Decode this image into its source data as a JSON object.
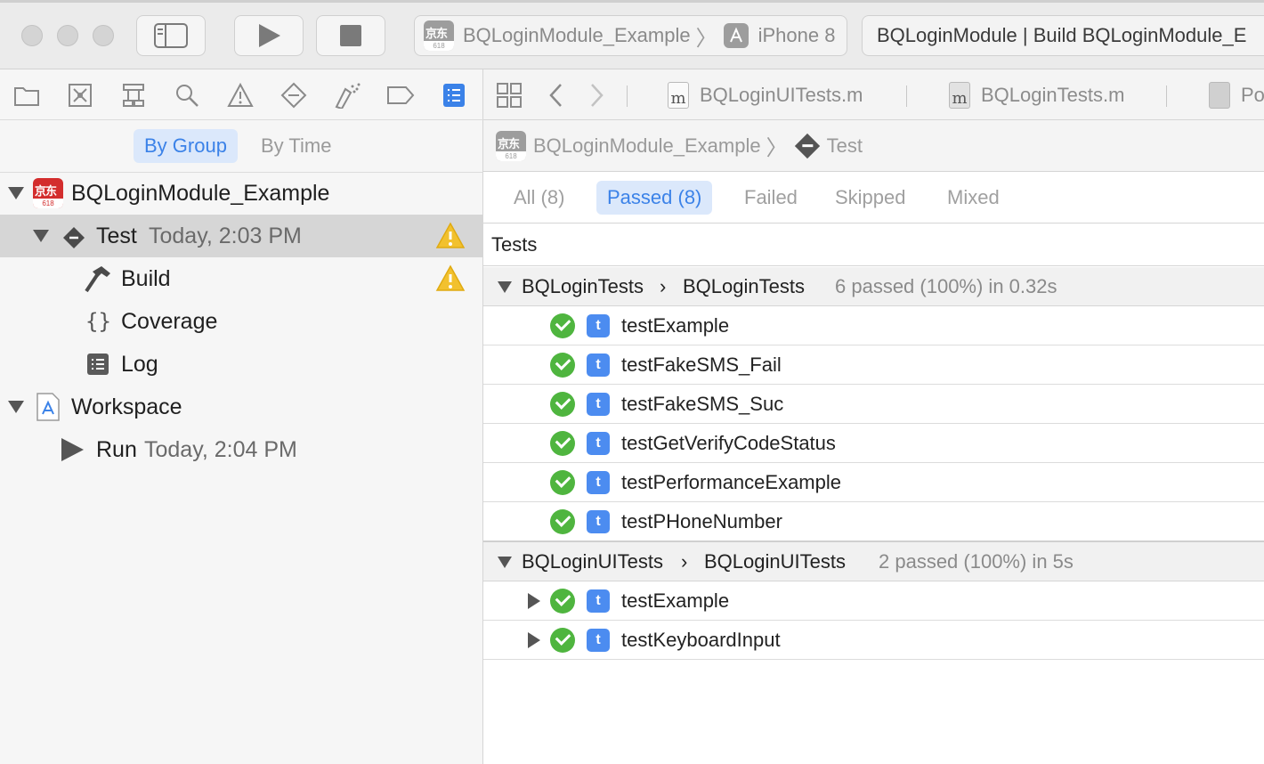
{
  "toolbar": {
    "scheme_name": "BQLoginModule_Example",
    "device_name": "iPhone 8",
    "status_text": "BQLoginModule | Build BQLoginModule_E",
    "app_icon_text": "京东",
    "app_icon_sub": "618"
  },
  "navigator": {
    "icons": [
      "folder-icon",
      "source-control-icon",
      "hierarchy-icon",
      "search-icon",
      "warning-icon",
      "test-icon",
      "debug-icon",
      "breakpoint-icon",
      "report-icon"
    ],
    "segments": {
      "by_group": "By Group",
      "by_time": "By Time"
    },
    "tree": {
      "project": {
        "label": "BQLoginModule_Example"
      },
      "test": {
        "label": "Test",
        "time": "Today, 2:03 PM"
      },
      "build": {
        "label": "Build"
      },
      "coverage": {
        "label": "Coverage"
      },
      "log": {
        "label": "Log"
      },
      "workspace": {
        "label": "Workspace"
      },
      "run": {
        "label": "Run",
        "time": "Today, 2:04 PM"
      }
    }
  },
  "editor": {
    "tabs": [
      "BQLoginUITests.m",
      "BQLoginTests.m",
      "Po"
    ],
    "breadcrumb": {
      "project": "BQLoginModule_Example",
      "item": "Test"
    },
    "filters": {
      "all": "All (8)",
      "passed": "Passed (8)",
      "failed": "Failed",
      "skipped": "Skipped",
      "mixed": "Mixed"
    },
    "tests_header": "Tests",
    "groups": [
      {
        "target": "BQLoginTests",
        "suite": "BQLoginTests",
        "summary": "6 passed (100%) in 0.32s",
        "tests": [
          "testExample",
          "testFakeSMS_Fail",
          "testFakeSMS_Suc",
          "testGetVerifyCodeStatus",
          "testPerformanceExample",
          "testPHoneNumber"
        ]
      },
      {
        "target": "BQLoginUITests",
        "suite": "BQLoginUITests",
        "summary": "2 passed (100%) in 5s",
        "tests": [
          "testExample",
          "testKeyboardInput"
        ]
      }
    ],
    "badge_letter": "t",
    "group_arrow": "›"
  },
  "colors": {
    "accent": "#3b82e8",
    "pass": "#4fb53f",
    "badge": "#4c8cf0",
    "warning": "#f2c12e"
  }
}
